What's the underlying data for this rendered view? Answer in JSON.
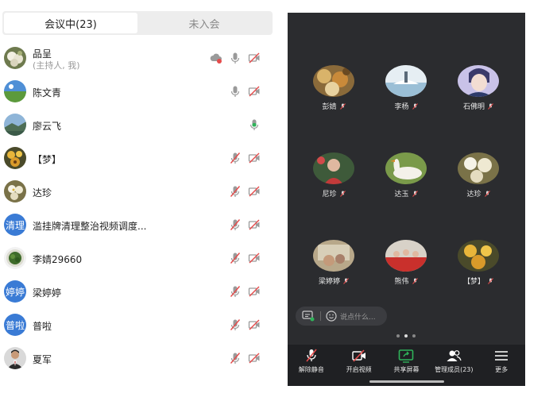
{
  "tabs": {
    "in_meeting": "会议中(23)",
    "not_joined": "未入会"
  },
  "participants": [
    {
      "name": "品呈",
      "sub": "(主持人, 我)",
      "avatar": "photo-flower",
      "icons": [
        "cloud-record-icon",
        "mic-on-icon",
        "camera-off-icon"
      ]
    },
    {
      "name": "陈文青",
      "sub": "",
      "avatar": "photo-landscape",
      "icons": [
        "mic-on-icon",
        "camera-off-icon"
      ]
    },
    {
      "name": "廖云飞",
      "sub": "",
      "avatar": "photo-sky",
      "icons": [
        "mic-active-icon"
      ]
    },
    {
      "name": "【梦】",
      "sub": "",
      "avatar": "photo-flower-yellow",
      "icons": [
        "mic-muted-icon",
        "camera-off-icon"
      ]
    },
    {
      "name": "达珍",
      "sub": "",
      "avatar": "photo-flower-white",
      "icons": [
        "mic-muted-icon",
        "camera-off-icon"
      ]
    },
    {
      "name": "滥挂牌清理整治视频调度...",
      "sub": "",
      "avatar": "清理",
      "icons": [
        "mic-muted-icon",
        "camera-off-icon"
      ]
    },
    {
      "name": "李婧29660",
      "sub": "",
      "avatar": "photo-plate",
      "icons": [
        "mic-muted-icon",
        "camera-off-icon"
      ]
    },
    {
      "name": "梁婷婷",
      "sub": "",
      "avatar": "婷婷",
      "icons": [
        "mic-muted-icon",
        "camera-off-icon"
      ]
    },
    {
      "name": "普啦",
      "sub": "",
      "avatar": "普啦",
      "icons": [
        "mic-muted-icon",
        "camera-off-icon"
      ]
    },
    {
      "name": "夏军",
      "sub": "",
      "avatar": "photo-man",
      "icons": [
        "mic-muted-icon",
        "camera-off-icon"
      ]
    }
  ],
  "video_grid": [
    {
      "name": "彭婧"
    },
    {
      "name": "李杨"
    },
    {
      "name": "石佛明"
    },
    {
      "name": "尼珍"
    },
    {
      "name": "达玉"
    },
    {
      "name": "达珍"
    },
    {
      "name": "梁婷婷"
    },
    {
      "name": "熊伟"
    },
    {
      "name": "【梦】"
    }
  ],
  "chat": {
    "placeholder": "说点什么..."
  },
  "toolbar": {
    "unmute": "解除静音",
    "start_video": "开启视频",
    "share_screen": "共享屏幕",
    "manage_members": "管理成员(23)",
    "more": "更多"
  },
  "pager": {
    "pages": 3,
    "current": 2
  },
  "colors": {
    "accent_blue": "#3a7bd5",
    "muted_red": "#e54b4b",
    "dark_bg": "#2b2c2f",
    "toolbar_bg": "#1f2023",
    "share_green": "#2fb35a"
  }
}
